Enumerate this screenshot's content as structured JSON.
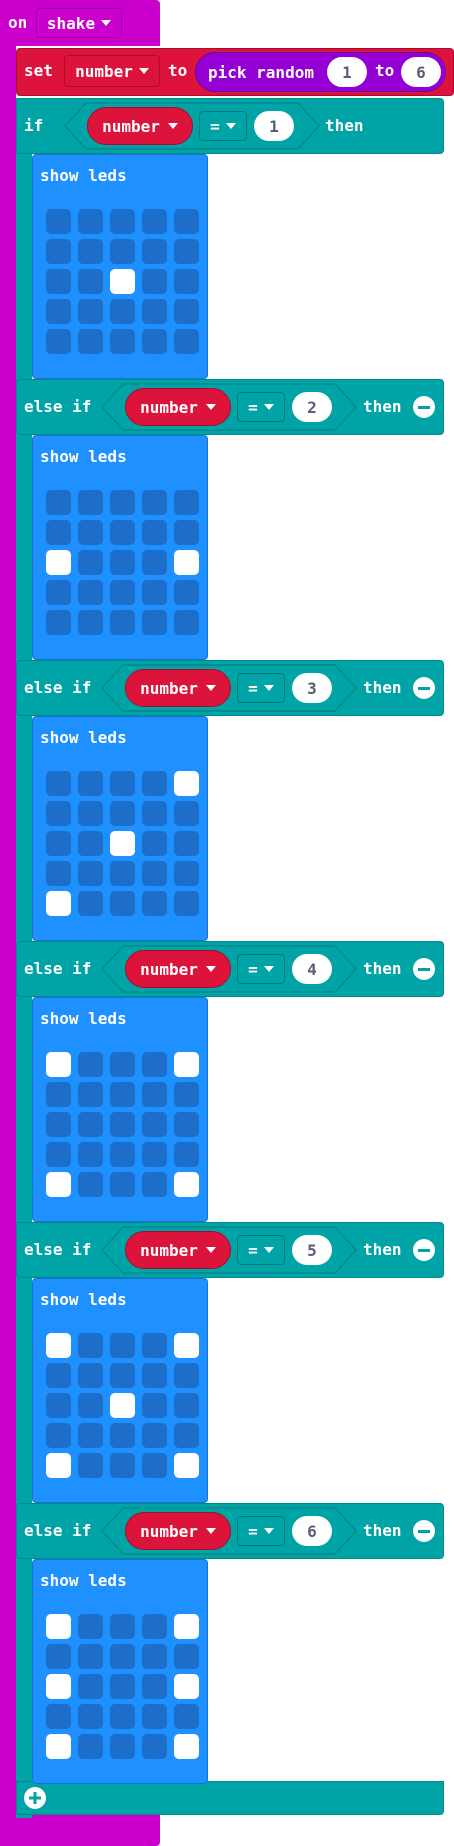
{
  "event": {
    "label": "on",
    "gesture": "shake"
  },
  "set_block": {
    "label": "set",
    "variable": "number",
    "to_label": "to"
  },
  "pick_random": {
    "label": "pick random",
    "from": "1",
    "to_label": "to",
    "to": "6"
  },
  "if_label": "if",
  "else_if_label": "else if",
  "then_label": "then",
  "show_leds_label": "show leds",
  "operator": "=",
  "variable": "number",
  "colors": {
    "event": "#cc00cc",
    "variables": "#dc143c",
    "math": "#9400d3",
    "logic": "#00a4a6",
    "basic": "#1e90ff",
    "led_off": "#1c6ec8",
    "led_on": "#ffffff"
  },
  "icons": {
    "dropdown": "caret-down-icon",
    "remove": "minus-circle-icon",
    "add": "plus-circle-icon"
  },
  "branches": [
    {
      "value": "1",
      "leds": [
        [
          0,
          0,
          0,
          0,
          0
        ],
        [
          0,
          0,
          0,
          0,
          0
        ],
        [
          0,
          0,
          1,
          0,
          0
        ],
        [
          0,
          0,
          0,
          0,
          0
        ],
        [
          0,
          0,
          0,
          0,
          0
        ]
      ]
    },
    {
      "value": "2",
      "leds": [
        [
          0,
          0,
          0,
          0,
          0
        ],
        [
          0,
          0,
          0,
          0,
          0
        ],
        [
          1,
          0,
          0,
          0,
          1
        ],
        [
          0,
          0,
          0,
          0,
          0
        ],
        [
          0,
          0,
          0,
          0,
          0
        ]
      ]
    },
    {
      "value": "3",
      "leds": [
        [
          0,
          0,
          0,
          0,
          1
        ],
        [
          0,
          0,
          0,
          0,
          0
        ],
        [
          0,
          0,
          1,
          0,
          0
        ],
        [
          0,
          0,
          0,
          0,
          0
        ],
        [
          1,
          0,
          0,
          0,
          0
        ]
      ]
    },
    {
      "value": "4",
      "leds": [
        [
          1,
          0,
          0,
          0,
          1
        ],
        [
          0,
          0,
          0,
          0,
          0
        ],
        [
          0,
          0,
          0,
          0,
          0
        ],
        [
          0,
          0,
          0,
          0,
          0
        ],
        [
          1,
          0,
          0,
          0,
          1
        ]
      ]
    },
    {
      "value": "5",
      "leds": [
        [
          1,
          0,
          0,
          0,
          1
        ],
        [
          0,
          0,
          0,
          0,
          0
        ],
        [
          0,
          0,
          1,
          0,
          0
        ],
        [
          0,
          0,
          0,
          0,
          0
        ],
        [
          1,
          0,
          0,
          0,
          1
        ]
      ]
    },
    {
      "value": "6",
      "leds": [
        [
          1,
          0,
          0,
          0,
          1
        ],
        [
          0,
          0,
          0,
          0,
          0
        ],
        [
          1,
          0,
          0,
          0,
          1
        ],
        [
          0,
          0,
          0,
          0,
          0
        ],
        [
          1,
          0,
          0,
          0,
          1
        ]
      ]
    }
  ]
}
